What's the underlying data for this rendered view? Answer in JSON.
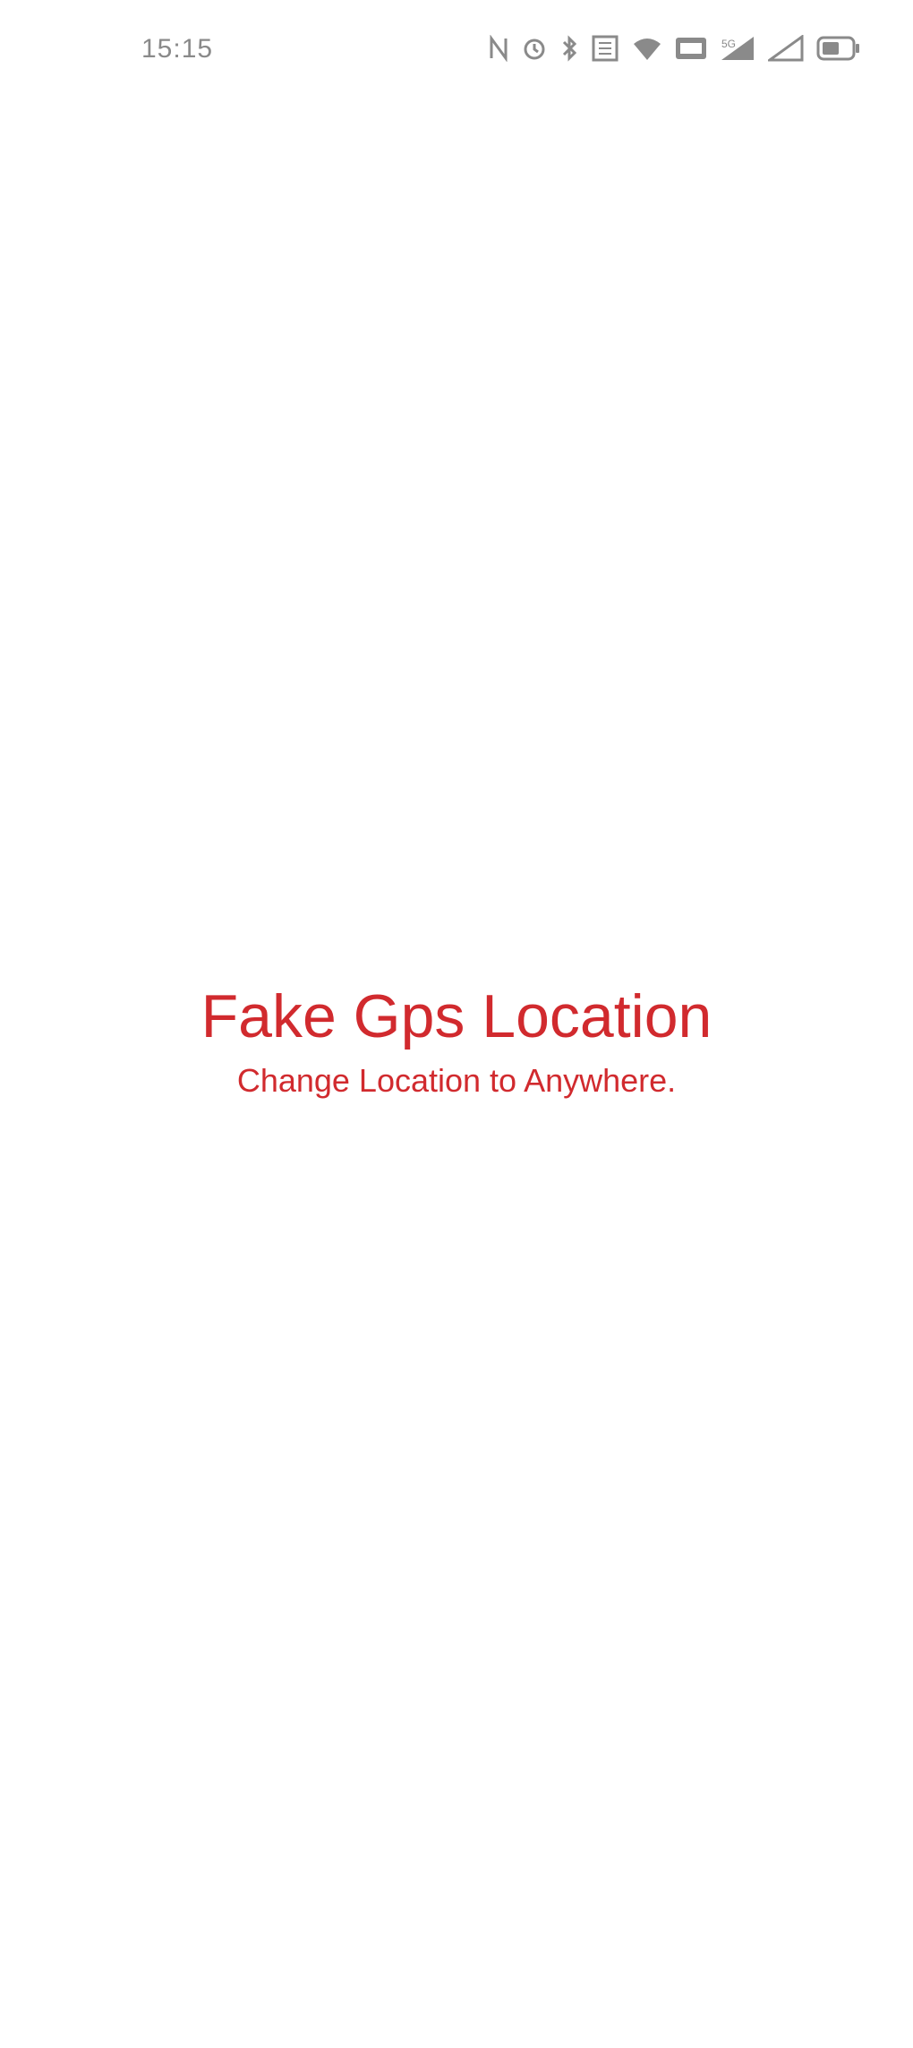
{
  "status_bar": {
    "time": "15:15",
    "icons": [
      "nfc-icon",
      "alarm-icon",
      "bluetooth-icon",
      "data-speed-icon",
      "wifi-icon",
      "volte-icon",
      "signal-icon",
      "signal-icon",
      "battery-icon"
    ]
  },
  "splash": {
    "title": "Fake Gps Location",
    "tagline": "Change Location to Anywhere.",
    "accent_color": "#d12a2e"
  }
}
